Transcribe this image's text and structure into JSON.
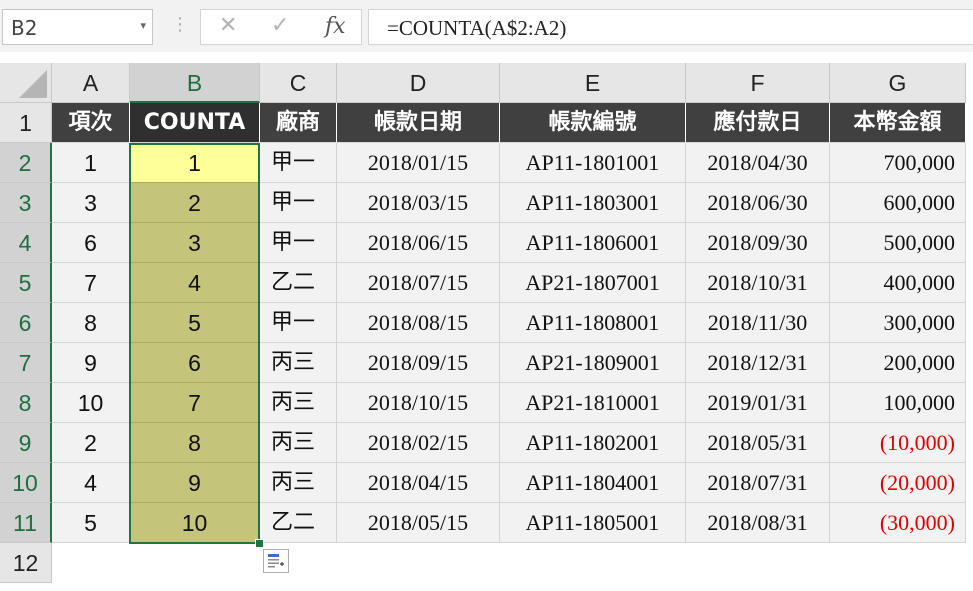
{
  "formula_bar": {
    "name_box": "B2",
    "separator": "⋮",
    "cancel_icon": "✕",
    "enter_icon": "✓",
    "fx_label": "fx",
    "formula": "=COUNTA(A$2:A2)"
  },
  "columns": [
    "A",
    "B",
    "C",
    "D",
    "E",
    "F",
    "G"
  ],
  "rows": [
    "1",
    "2",
    "3",
    "4",
    "5",
    "6",
    "7",
    "8",
    "9",
    "10",
    "11",
    "12"
  ],
  "header_row": [
    "項次",
    "COUNTA",
    "廠商",
    "帳款日期",
    "帳款編號",
    "應付款日",
    "本幣金額"
  ],
  "data": [
    {
      "a": "1",
      "b": "1",
      "vendor": "甲一",
      "date": "2018/01/15",
      "id": "AP11-1801001",
      "due": "2018/04/30",
      "amount": "700,000"
    },
    {
      "a": "3",
      "b": "2",
      "vendor": "甲一",
      "date": "2018/03/15",
      "id": "AP11-1803001",
      "due": "2018/06/30",
      "amount": "600,000"
    },
    {
      "a": "6",
      "b": "3",
      "vendor": "甲一",
      "date": "2018/06/15",
      "id": "AP11-1806001",
      "due": "2018/09/30",
      "amount": "500,000"
    },
    {
      "a": "7",
      "b": "4",
      "vendor": "乙二",
      "date": "2018/07/15",
      "id": "AP21-1807001",
      "due": "2018/10/31",
      "amount": "400,000"
    },
    {
      "a": "8",
      "b": "5",
      "vendor": "甲一",
      "date": "2018/08/15",
      "id": "AP11-1808001",
      "due": "2018/11/30",
      "amount": "300,000"
    },
    {
      "a": "9",
      "b": "6",
      "vendor": "丙三",
      "date": "2018/09/15",
      "id": "AP21-1809001",
      "due": "2018/12/31",
      "amount": "200,000"
    },
    {
      "a": "10",
      "b": "7",
      "vendor": "丙三",
      "date": "2018/10/15",
      "id": "AP21-1810001",
      "due": "2019/01/31",
      "amount": "100,000"
    },
    {
      "a": "2",
      "b": "8",
      "vendor": "丙三",
      "date": "2018/02/15",
      "id": "AP11-1802001",
      "due": "2018/05/31",
      "amount": "(10,000)"
    },
    {
      "a": "4",
      "b": "9",
      "vendor": "丙三",
      "date": "2018/04/15",
      "id": "AP11-1804001",
      "due": "2018/07/31",
      "amount": "(20,000)"
    },
    {
      "a": "5",
      "b": "10",
      "vendor": "乙二",
      "date": "2018/05/15",
      "id": "AP11-1805001",
      "due": "2018/08/31",
      "amount": "(30,000)"
    }
  ],
  "colors": {
    "header_fill": "#404040",
    "selection_fill": "#c4c47a",
    "active_cell_fill": "#ffff99",
    "negative_text": "#e00000",
    "selection_border": "#217346"
  },
  "icons": {
    "quick_analysis": "quick-analysis-icon",
    "select_all": "select-all-triangle-icon"
  }
}
